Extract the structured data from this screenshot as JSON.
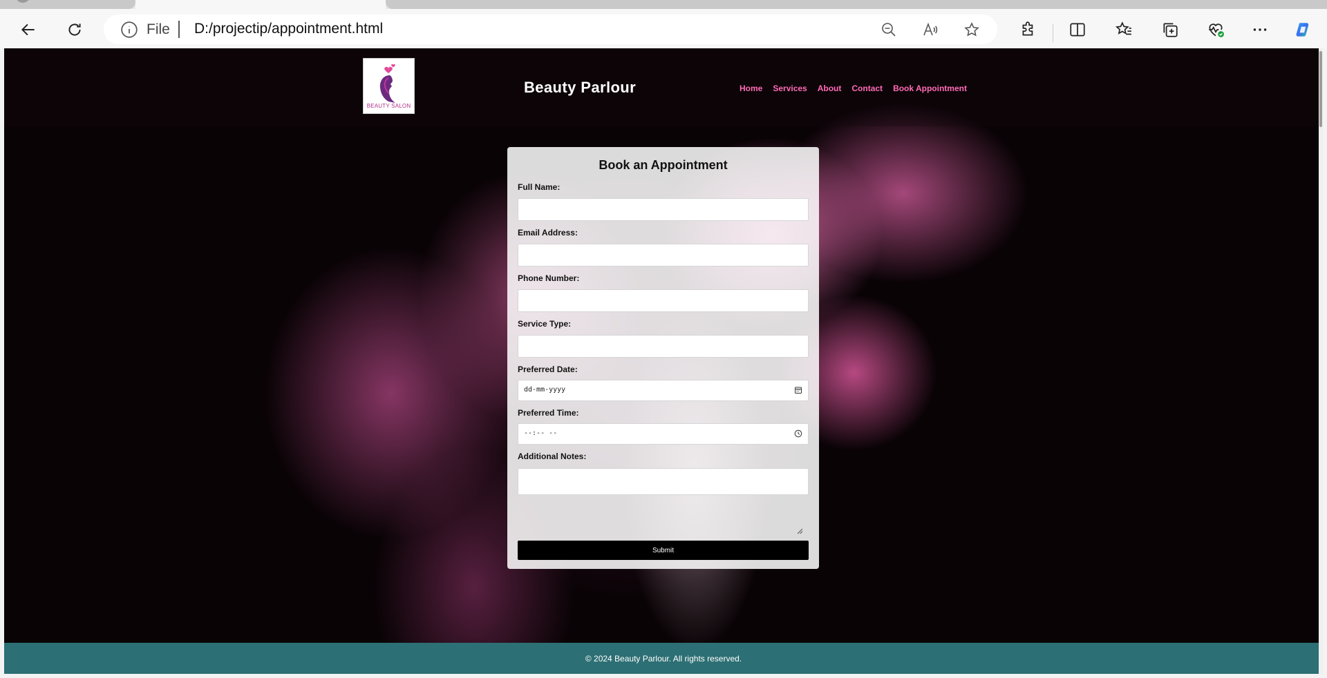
{
  "browser": {
    "address": {
      "scheme_label": "File",
      "url": "D:/projectip/appointment.html"
    },
    "icons": [
      "back-icon",
      "refresh-icon",
      "info-icon",
      "zoom-out-icon",
      "read-aloud-icon",
      "favorite-star-icon",
      "extensions-icon",
      "split-screen-icon",
      "favorites-icon",
      "collections-icon",
      "browser-essentials-icon",
      "more-icon",
      "copilot-icon"
    ]
  },
  "site": {
    "logo_text": "BEAUTY SALON",
    "title": "Beauty Parlour",
    "nav": [
      "Home",
      "Services",
      "About",
      "Contact",
      "Book Appointment"
    ]
  },
  "form": {
    "title": "Book an Appointment",
    "fields": {
      "full_name": {
        "label": "Full Name:",
        "value": ""
      },
      "email": {
        "label": "Email Address:",
        "value": ""
      },
      "phone": {
        "label": "Phone Number:",
        "value": ""
      },
      "service_type": {
        "label": "Service Type:",
        "value": ""
      },
      "preferred_date": {
        "label": "Preferred Date:",
        "placeholder": "dd-mm-yyyy"
      },
      "preferred_time": {
        "label": "Preferred Time:",
        "placeholder": "--:-- --"
      },
      "notes": {
        "label": "Additional Notes:",
        "value": ""
      }
    },
    "submit_label": "Submit"
  },
  "footer": {
    "text": "© 2024 Beauty Parlour. All rights reserved."
  },
  "colors": {
    "nav_link": "#ff6bb5",
    "footer_bg": "#2c6f74",
    "submit_bg": "#000000"
  }
}
